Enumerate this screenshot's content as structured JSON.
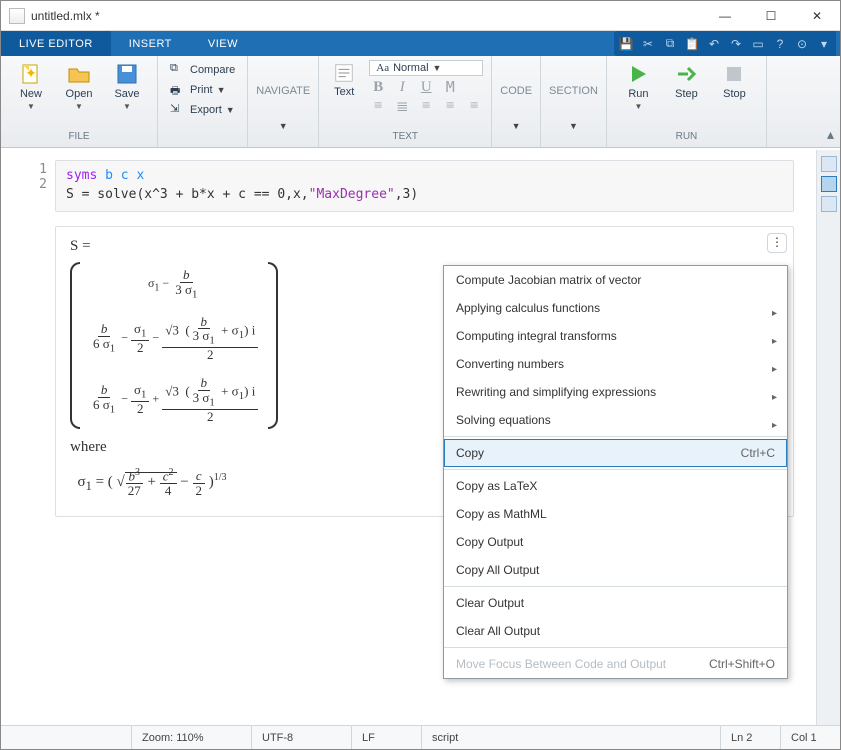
{
  "window": {
    "title": "untitled.mlx *"
  },
  "ribbon_tabs": [
    "LIVE EDITOR",
    "INSERT",
    "VIEW"
  ],
  "toolstrip": {
    "file": {
      "new": "New",
      "open": "Open",
      "save": "Save",
      "compare": "Compare",
      "print": "Print",
      "export": "Export",
      "group": "FILE"
    },
    "navigate": {
      "label": "NAVIGATE"
    },
    "text": {
      "text_btn": "Text",
      "style": "Normal",
      "group": "TEXT"
    },
    "code": {
      "label": "CODE"
    },
    "section": {
      "label": "SECTION"
    },
    "run": {
      "run": "Run",
      "step": "Step",
      "stop": "Stop",
      "group": "RUN"
    }
  },
  "gutter": {
    "l1": "1",
    "l2": "2"
  },
  "code": {
    "l1_kw": "syms",
    "l1_vars": "b c x",
    "l2_pre": "S = solve(x^3 + b*x + c == 0,x,",
    "l2_str": "\"MaxDegree\"",
    "l2_post": ",3)"
  },
  "output": {
    "lhs": "S =",
    "where": "where"
  },
  "context_menu": {
    "items": [
      {
        "label": "Compute Jacobian matrix of vector",
        "sub": false
      },
      {
        "label": "Applying calculus functions",
        "sub": true
      },
      {
        "label": "Computing integral transforms",
        "sub": true
      },
      {
        "label": "Converting numbers",
        "sub": true
      },
      {
        "label": "Rewriting and simplifying expressions",
        "sub": true
      },
      {
        "label": "Solving equations",
        "sub": true
      }
    ],
    "copy": {
      "label": "Copy",
      "shortcut": "Ctrl+C"
    },
    "copy_latex": "Copy as LaTeX",
    "copy_mathml": "Copy as MathML",
    "copy_output": "Copy Output",
    "copy_all": "Copy All Output",
    "clear_output": "Clear Output",
    "clear_all": "Clear All Output",
    "move_focus": {
      "label": "Move Focus Between Code and Output",
      "shortcut": "Ctrl+Shift+O"
    }
  },
  "status": {
    "zoom": "Zoom: 110%",
    "enc": "UTF-8",
    "eol": "LF",
    "mode": "script",
    "ln": "Ln  2",
    "col": "Col  1"
  }
}
